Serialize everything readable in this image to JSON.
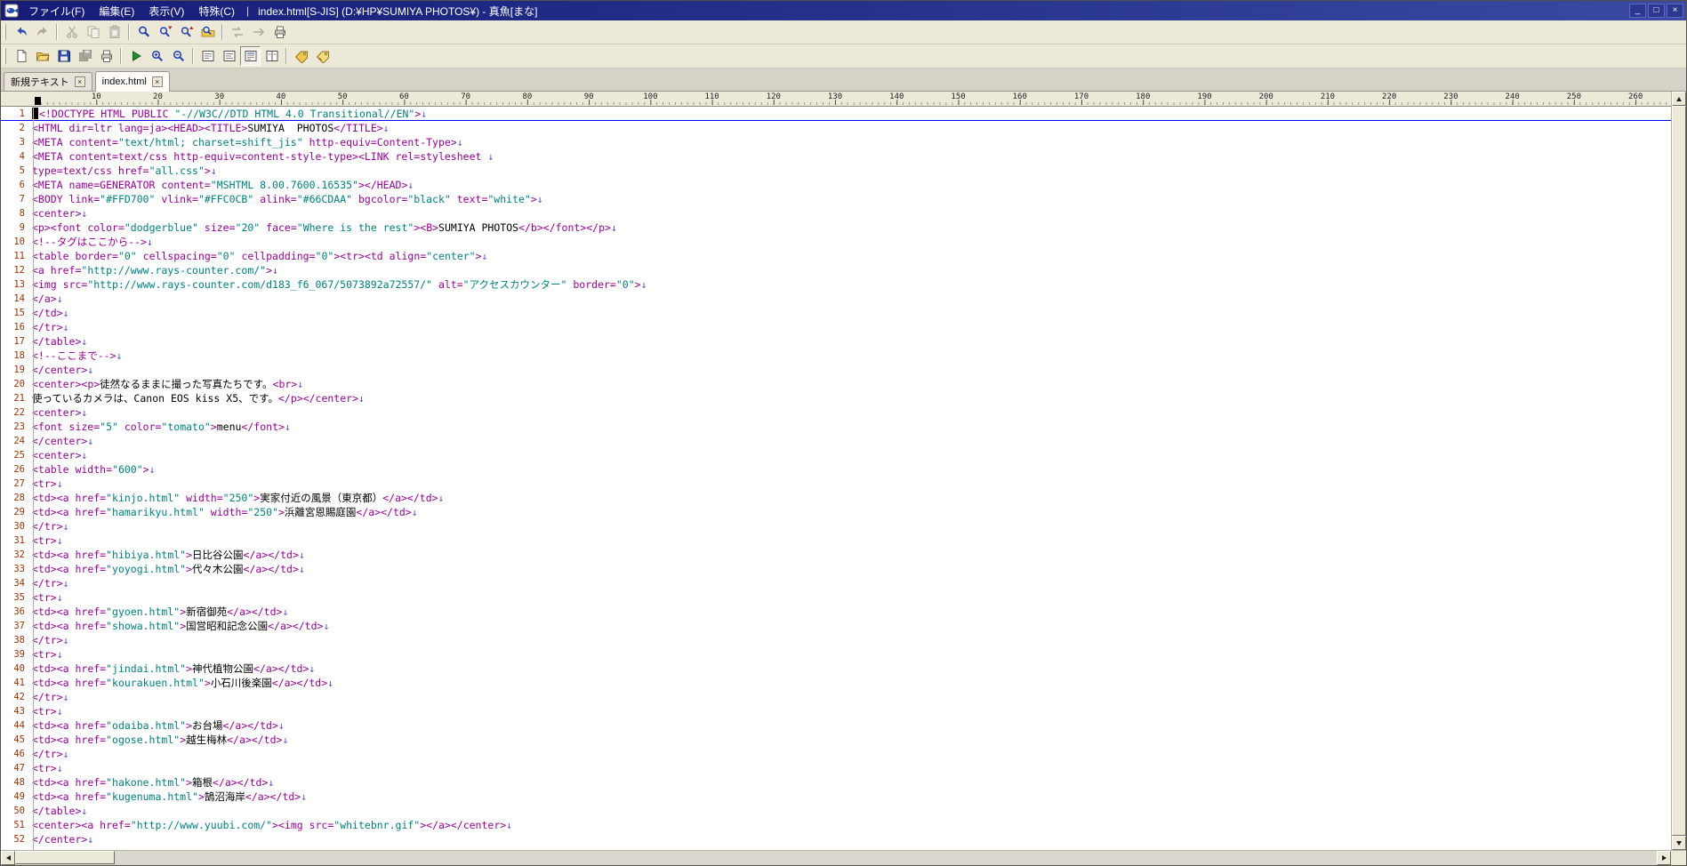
{
  "titlebar": {
    "title": "index.html[S-JIS] (D:¥HP¥SUMIYA PHOTOS¥) - 真魚[まな]",
    "separator": "|",
    "menus": [
      {
        "name": "menu-file",
        "label": "ファイル(F)"
      },
      {
        "name": "menu-edit",
        "label": "編集(E)"
      },
      {
        "name": "menu-view",
        "label": "表示(V)"
      },
      {
        "name": "menu-special",
        "label": "特殊(C)"
      }
    ],
    "controls": [
      {
        "name": "minimize-button",
        "glyph": "_"
      },
      {
        "name": "maximize-button",
        "glyph": "□"
      },
      {
        "name": "close-button",
        "glyph": "×"
      }
    ]
  },
  "toolbar1": {
    "buttons": [
      {
        "name": "undo-button",
        "icon": "undo",
        "enabled": true
      },
      {
        "name": "redo-button",
        "icon": "redo",
        "enabled": false
      },
      {
        "sep": true
      },
      {
        "name": "cut-button",
        "icon": "cut",
        "enabled": false
      },
      {
        "name": "copy-button",
        "icon": "copy",
        "enabled": false
      },
      {
        "name": "paste-button",
        "icon": "paste",
        "enabled": false
      },
      {
        "sep": true
      },
      {
        "name": "find-button",
        "icon": "find",
        "enabled": true
      },
      {
        "name": "find-next-button",
        "icon": "findnext",
        "enabled": true
      },
      {
        "name": "find-prev-button",
        "icon": "findprev",
        "enabled": true
      },
      {
        "name": "find-in-files-button",
        "icon": "grep",
        "enabled": true
      },
      {
        "sep": true
      },
      {
        "name": "replace-button",
        "icon": "replace",
        "enabled": false
      },
      {
        "name": "jump-button",
        "icon": "jump",
        "enabled": false
      },
      {
        "name": "print-preview-button",
        "icon": "print",
        "enabled": true
      }
    ]
  },
  "toolbar2": {
    "buttons": [
      {
        "name": "new-button",
        "icon": "newdoc",
        "enabled": true
      },
      {
        "name": "open-button",
        "icon": "open",
        "enabled": true
      },
      {
        "name": "save-button",
        "icon": "save",
        "enabled": true
      },
      {
        "name": "save-all-button",
        "icon": "saveall",
        "enabled": false
      },
      {
        "name": "print-button",
        "icon": "print",
        "enabled": true
      },
      {
        "sep": true
      },
      {
        "name": "browser-run-button",
        "icon": "run",
        "enabled": true
      },
      {
        "name": "zoom-in-button",
        "icon": "zoomin",
        "enabled": true
      },
      {
        "name": "zoom-out-button",
        "icon": "zoomout",
        "enabled": true
      },
      {
        "sep": true
      },
      {
        "name": "wrap-off-button",
        "icon": "mode1",
        "enabled": true
      },
      {
        "name": "wrap-window-button",
        "icon": "mode2",
        "enabled": true
      },
      {
        "name": "wrap-column-button",
        "icon": "mode3",
        "enabled": true,
        "pressed": true
      },
      {
        "name": "split-view-button",
        "icon": "mode4",
        "enabled": true
      },
      {
        "sep": true
      },
      {
        "name": "insert-tag-button",
        "icon": "tag1",
        "enabled": true
      },
      {
        "name": "edit-tag-button",
        "icon": "tag2",
        "enabled": true
      }
    ]
  },
  "tabs": {
    "close_glyph": "×",
    "items": [
      {
        "name": "tab-untitled",
        "label": "新規テキスト",
        "active": false
      },
      {
        "name": "tab-index-html",
        "label": "index.html",
        "active": true
      }
    ]
  },
  "ruler": {
    "labels": [
      "10",
      "20",
      "30",
      "40",
      "50",
      "60",
      "70",
      "80",
      "90",
      "100",
      "110",
      "120",
      "130",
      "140",
      "150",
      "160",
      "170",
      "180",
      "190",
      "200",
      "210",
      "220",
      "230",
      "240",
      "250",
      "260"
    ]
  },
  "editor": {
    "current_line": 1,
    "caret": {
      "line": 1,
      "col": 0
    },
    "newline_mark": "↓",
    "colors": {
      "tag": "#990099",
      "string": "#008080",
      "text": "#000000",
      "newline": "#5a52cc",
      "line_number": "#993300",
      "current_line_underline": "#0000ff"
    },
    "lines": [
      "<!DOCTYPE HTML PUBLIC \"-//W3C//DTD HTML 4.0 Transitional//EN\">",
      "<HTML dir=ltr lang=ja><HEAD><TITLE>SUMIYA  PHOTOS</TITLE>",
      "<META content=\"text/html; charset=shift_jis\" http-equiv=Content-Type>",
      "<META content=text/css http-equiv=content-style-type><LINK rel=stylesheet ",
      "type=text/css href=\"all.css\">",
      "<META name=GENERATOR content=\"MSHTML 8.00.7600.16535\"></HEAD>",
      "<BODY link=\"#FFD700\" vlink=\"#FFC0CB\" alink=\"#66CDAA\" bgcolor=\"black\" text=\"white\">",
      "<center>",
      "<p><font color=\"dodgerblue\" size=\"20\" face=\"Where is the rest\"><B>SUMIYA PHOTOS</b></font></p>",
      "<!--タグはここから-->",
      "<table border=\"0\" cellspacing=\"0\" cellpadding=\"0\"><tr><td align=\"center\">",
      "<a href=\"http://www.rays-counter.com/\">",
      "<img src=\"http://www.rays-counter.com/d183_f6_067/5073892a72557/\" alt=\"アクセスカウンター\" border=\"0\">",
      "</a>",
      "</td>",
      "</tr>",
      "</table>",
      "<!--ここまで-->",
      "</center>",
      "<center><p>徒然なるままに撮った写真たちです。<br>",
      "使っているカメラは、Canon EOS kiss X5、です。</p></center>",
      "<center>",
      "<font size=\"5\" color=\"tomato\">menu</font>",
      "</center>",
      "<center>",
      "<table width=\"600\">",
      "<tr>",
      "<td><a href=\"kinjo.html\" width=\"250\">実家付近の風景（東京都）</a></td>",
      "<td><a href=\"hamarikyu.html\" width=\"250\">浜離宮恩賜庭園</a></td>",
      "</tr>",
      "<tr>",
      "<td><a href=\"hibiya.html\">日比谷公園</a></td>",
      "<td><a href=\"yoyogi.html\">代々木公園</a></td>",
      "</tr>",
      "<tr>",
      "<td><a href=\"gyoen.html\">新宿御苑</a></td>",
      "<td><a href=\"showa.html\">国営昭和記念公園</a></td>",
      "</tr>",
      "<tr>",
      "<td><a href=\"jindai.html\">神代植物公園</a></td>",
      "<td><a href=\"kourakuen.html\">小石川後楽園</a></td>",
      "</tr>",
      "<tr>",
      "<td><a href=\"odaiba.html\">お台場</a></td>",
      "<td><a href=\"ogose.html\">越生梅林</a></td>",
      "</tr>",
      "<tr>",
      "<td><a href=\"hakone.html\">箱根</a></td>",
      "<td><a href=\"kugenuma.html\">鵠沼海岸</a></td>",
      "</table>",
      "<center><a href=\"http://www.yuubi.com/\"><img src=\"whitebnr.gif\"></a></center>",
      "</center>"
    ]
  }
}
